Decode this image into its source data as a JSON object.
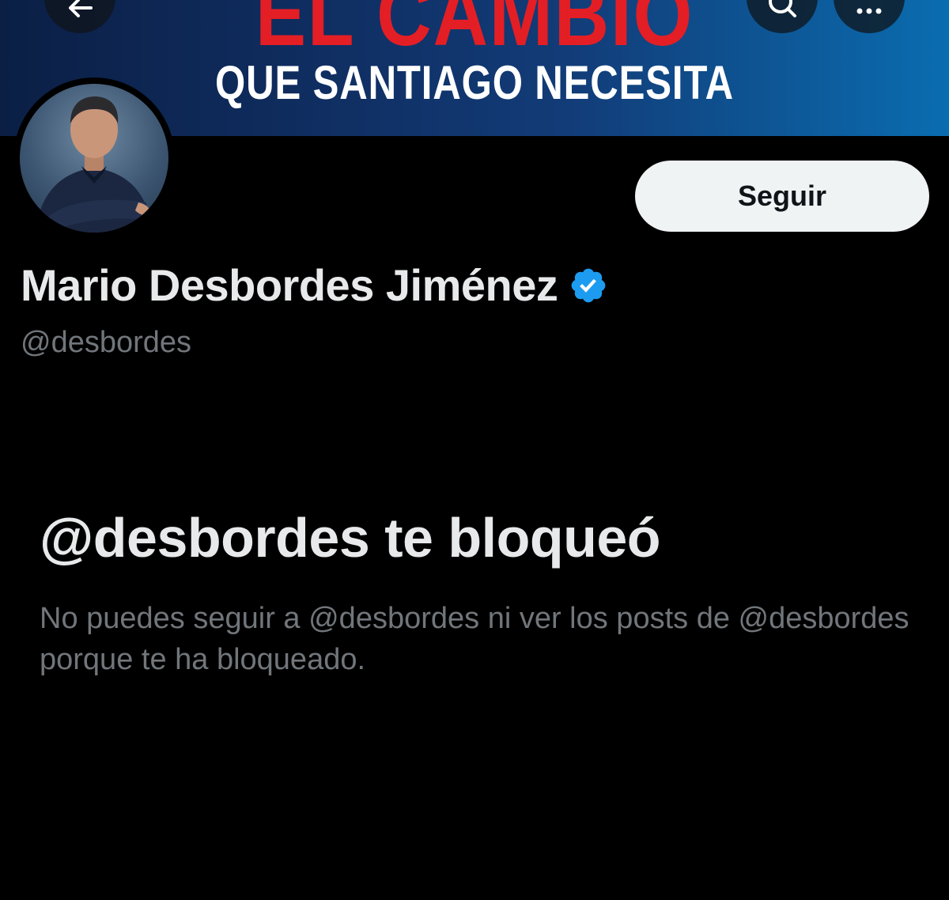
{
  "banner": {
    "line1": "EL CAMBIO",
    "line2": "QUE SANTIAGO NECESITA"
  },
  "nav": {
    "back_icon": "arrow-left-icon",
    "search_icon": "search-icon",
    "more_icon": "more-horizontal-icon"
  },
  "profile": {
    "display_name": "Mario Desbordes Jiménez",
    "handle": "@desbordes",
    "verified_icon": "verified-badge-icon",
    "follow_label": "Seguir"
  },
  "blocked": {
    "title": "@desbordes te bloqueó",
    "message": "No puedes seguir a @desbordes ni ver los posts de @desbordes porque te ha bloqueado."
  },
  "colors": {
    "background": "#000000",
    "primary_text": "#e7e9ea",
    "secondary_text": "#71767b",
    "verified_blue": "#1d9bf0",
    "banner_red": "#e41e25",
    "follow_button_bg": "#eff3f4"
  }
}
